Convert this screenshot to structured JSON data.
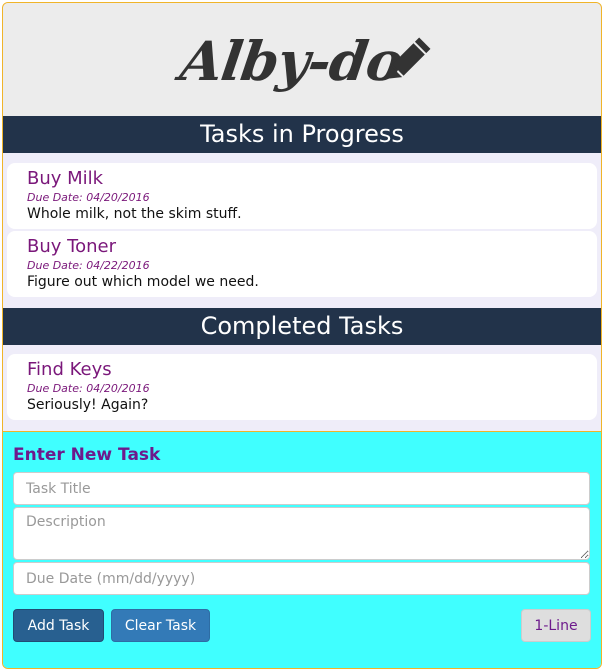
{
  "logo": {
    "text": "Alby-do"
  },
  "sections": {
    "in_progress": "Tasks in Progress",
    "completed": "Completed Tasks"
  },
  "tasks_in_progress": [
    {
      "title": "Buy Milk",
      "due": "Due Date: 04/20/2016",
      "description": "Whole milk, not the skim stuff."
    },
    {
      "title": "Buy Toner",
      "due": "Due Date: 04/22/2016",
      "description": "Figure out which model we need."
    }
  ],
  "tasks_completed": [
    {
      "title": "Find Keys",
      "due": "Due Date: 04/20/2016",
      "description": "Seriously! Again?"
    }
  ],
  "form": {
    "heading": "Enter New Task",
    "title_placeholder": "Task Title",
    "title_value": "",
    "description_placeholder": "Description",
    "description_value": "",
    "due_placeholder": "Due Date (mm/dd/yyyy)",
    "due_value": "",
    "add_label": "Add Task",
    "clear_label": "Clear Task",
    "one_line_label": "1-Line"
  },
  "colors": {
    "accent_purple": "#7a177a",
    "section_bar": "#22334a",
    "form_background": "#40ffff",
    "border": "#f0b429"
  }
}
